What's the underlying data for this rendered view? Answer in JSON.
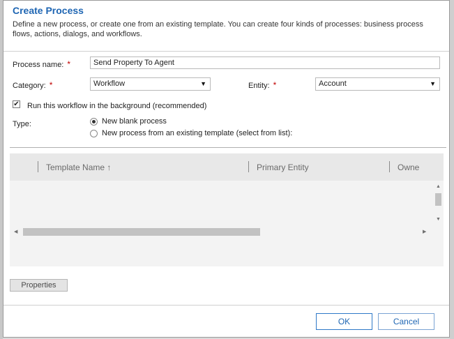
{
  "dialog": {
    "title": "Create Process",
    "description": "Define a new process, or create one from an existing template. You can create four kinds of processes: business process flows, actions, dialogs, and workflows."
  },
  "form": {
    "process_name": {
      "label": "Process name:",
      "required_mark": "*",
      "value": "Send Property To Agent"
    },
    "category": {
      "label": "Category:",
      "required_mark": "*",
      "selected": "Workflow"
    },
    "entity": {
      "label": "Entity:",
      "required_mark": "*",
      "selected": "Account"
    },
    "background": {
      "label": "Run this workflow in the background (recommended)",
      "checked": true
    },
    "type": {
      "label": "Type:",
      "options": [
        {
          "label": "New blank process",
          "selected": true
        },
        {
          "label": "New process from an existing template (select from list):",
          "selected": false
        }
      ]
    }
  },
  "template_grid": {
    "columns": [
      "Template Name ↑",
      "Primary Entity",
      "Owne"
    ]
  },
  "buttons": {
    "properties": "Properties",
    "ok": "OK",
    "cancel": "Cancel"
  },
  "glyphs": {
    "dropdown": "▼",
    "check": "✔",
    "up": "▲",
    "down": "▼",
    "left": "◀",
    "right": "▶"
  },
  "colors": {
    "title": "#1f66b3",
    "required": "#c00000",
    "ok_border": "#2e78c8"
  }
}
